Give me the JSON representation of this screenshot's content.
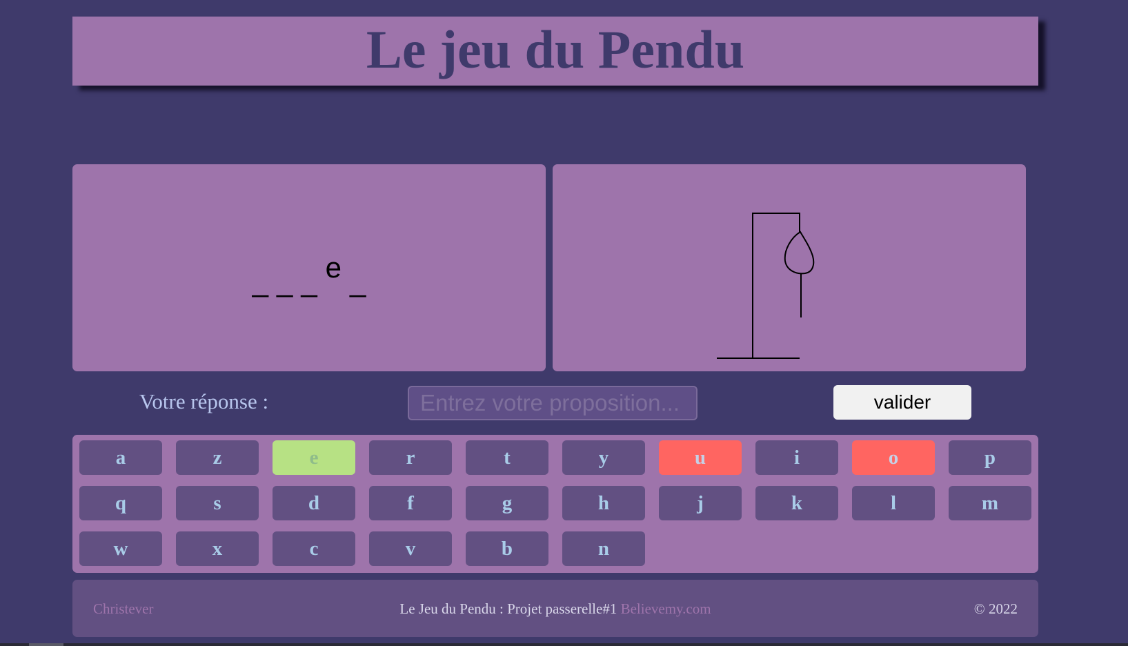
{
  "header": {
    "title": "Le jeu du Pendu"
  },
  "word": {
    "letters": [
      "_",
      "_",
      "_",
      "e",
      "_"
    ]
  },
  "answer": {
    "label": "Votre réponse :",
    "placeholder": "Entrez votre proposition...",
    "submit_label": "valider"
  },
  "keyboard": {
    "rows": [
      [
        {
          "letter": "a",
          "state": "normal"
        },
        {
          "letter": "z",
          "state": "normal"
        },
        {
          "letter": "e",
          "state": "correct"
        },
        {
          "letter": "r",
          "state": "normal"
        },
        {
          "letter": "t",
          "state": "normal"
        },
        {
          "letter": "y",
          "state": "normal"
        },
        {
          "letter": "u",
          "state": "wrong"
        },
        {
          "letter": "i",
          "state": "normal"
        },
        {
          "letter": "o",
          "state": "wrong"
        },
        {
          "letter": "p",
          "state": "normal"
        }
      ],
      [
        {
          "letter": "q",
          "state": "normal"
        },
        {
          "letter": "s",
          "state": "normal"
        },
        {
          "letter": "d",
          "state": "normal"
        },
        {
          "letter": "f",
          "state": "normal"
        },
        {
          "letter": "g",
          "state": "normal"
        },
        {
          "letter": "h",
          "state": "normal"
        },
        {
          "letter": "j",
          "state": "normal"
        },
        {
          "letter": "k",
          "state": "normal"
        },
        {
          "letter": "l",
          "state": "normal"
        },
        {
          "letter": "m",
          "state": "normal"
        }
      ],
      [
        {
          "letter": "w",
          "state": "normal"
        },
        {
          "letter": "x",
          "state": "normal"
        },
        {
          "letter": "c",
          "state": "normal"
        },
        {
          "letter": "v",
          "state": "normal"
        },
        {
          "letter": "b",
          "state": "normal"
        },
        {
          "letter": "n",
          "state": "normal"
        }
      ]
    ]
  },
  "footer": {
    "author": "Christever",
    "project": "Le Jeu du Pendu : Projet passerelle#1 ",
    "link": "Believemy.com",
    "copyright": "© 2022"
  },
  "colors": {
    "background": "#3f3a6b",
    "panel": "#9e74ab",
    "key": "#625082",
    "correct": "#b7e184",
    "wrong": "#ff6561"
  }
}
